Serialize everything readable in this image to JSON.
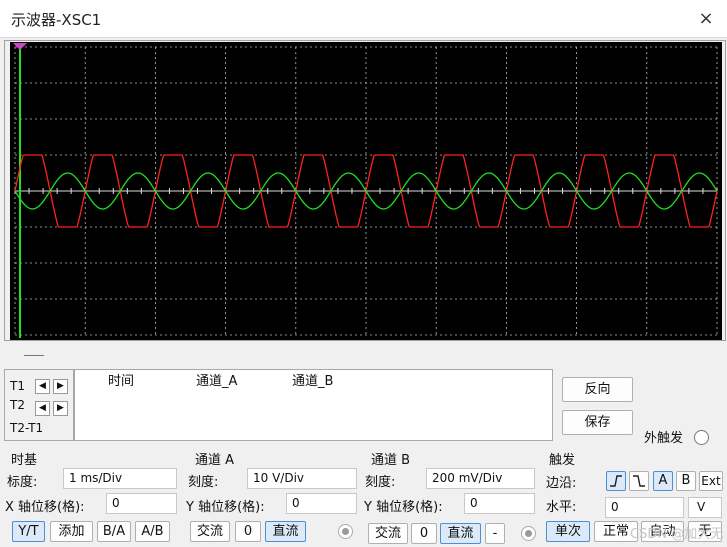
{
  "window": {
    "title": "示波器-XSC1",
    "close_icon": "×"
  },
  "screen": {
    "background": "#000000",
    "grid_color": "#bbbbbb",
    "channel_a_color": "#ff2020",
    "channel_b_color": "#20e020",
    "marker_color": "#cc44cc"
  },
  "chart_data": {
    "type": "line",
    "x_range_div": [
      0,
      10
    ],
    "y_range_div": [
      -4,
      4
    ],
    "time_per_div_ms": 1,
    "grid": true,
    "series": [
      {
        "channel": "A",
        "waveform": "clipped-sine",
        "amplitude_div": 1.5,
        "clip_level_div": 1.0,
        "period_div": 1.0,
        "phase_div": 0.0,
        "color": "#ff2020"
      },
      {
        "channel": "B",
        "waveform": "sine",
        "amplitude_div": 0.5,
        "period_div": 1.0,
        "phase_div": 0.5,
        "color": "#20e020"
      }
    ]
  },
  "cursors": {
    "t1": "T1",
    "t2": "T2",
    "t2_t1": "T2-T1"
  },
  "readout": {
    "col_time": "时间",
    "col_a": "通道_A",
    "col_b": "通道_B"
  },
  "buttons": {
    "reverse": "反向",
    "save": "保存"
  },
  "ext_trigger": "外触发",
  "timebase": {
    "title": "时基",
    "scale_label": "标度:",
    "scale_value": "1 ms/Div",
    "xpos_label": "X 轴位移(格):",
    "xpos_value": "0",
    "modes": [
      "Y/T",
      "添加",
      "B/A",
      "A/B"
    ]
  },
  "channel_a": {
    "title": "通道 A",
    "scale_label": "刻度:",
    "scale_value": "10  V/Div",
    "ypos_label": "Y 轴位移(格):",
    "ypos_value": "0",
    "coupling": [
      "交流",
      "0",
      "直流"
    ]
  },
  "channel_b": {
    "title": "通道 B",
    "scale_label": "刻度:",
    "scale_value": "200 mV/Div",
    "ypos_label": "Y 轴位移(格):",
    "ypos_value": "0",
    "coupling": [
      "交流",
      "0",
      "直流",
      "-"
    ]
  },
  "trigger": {
    "title": "触发",
    "edge_label": "边沿:",
    "sources": [
      "A",
      "B",
      "Ext"
    ],
    "level_label": "水平:",
    "level_value": "0",
    "level_unit": "V",
    "modes": [
      "单次",
      "正常",
      "自动",
      "无"
    ]
  },
  "watermark": "CSDN @加大无"
}
